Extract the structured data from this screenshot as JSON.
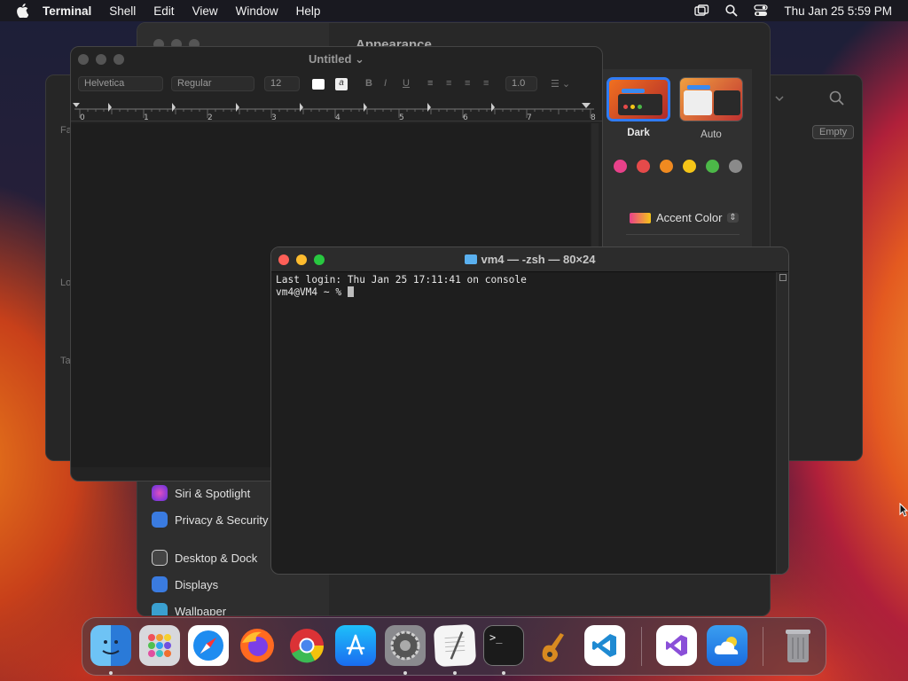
{
  "menubar": {
    "app": "Terminal",
    "items": [
      "Shell",
      "Edit",
      "View",
      "Window",
      "Help"
    ],
    "clock": "Thu Jan 25  5:59 PM"
  },
  "settings": {
    "header_partial": "Appearance",
    "sidebar": [
      {
        "label": "Siri & Spotlight",
        "color": "#b040c0"
      },
      {
        "label": "Privacy & Security",
        "color": "#3a7be0"
      },
      {
        "label": "Desktop & Dock",
        "color": "#555"
      },
      {
        "label": "Displays",
        "color": "#3a7be0"
      },
      {
        "label": "Wallpaper",
        "color": "#3aa0d0"
      }
    ],
    "appearance": {
      "options": [
        {
          "label": "Dark",
          "selected": true
        },
        {
          "label": "Auto",
          "selected": false
        }
      ],
      "accent_colors": [
        "#e8418a",
        "#e54a4a",
        "#f08a20",
        "#f5c518",
        "#4cb848",
        "#8a8a8a"
      ],
      "accent_label": "Accent Color"
    }
  },
  "back_window": {
    "empty_label": "Empty",
    "partial_labels": [
      "Fa",
      "Lo",
      "Ta"
    ]
  },
  "textedit": {
    "title": "Untitled",
    "font": "Helvetica",
    "style": "Regular",
    "size": "12",
    "spacing": "1.0",
    "ruler": [
      "0",
      "1",
      "2",
      "3",
      "4",
      "5",
      "6",
      "7",
      "8"
    ]
  },
  "terminal": {
    "title": "vm4 — -zsh — 80×24",
    "lines": [
      "Last login: Thu Jan 25 17:11:41 on console",
      "vm4@VM4 ~ % "
    ]
  },
  "dock": {
    "apps": [
      "finder",
      "launchpad",
      "safari",
      "firefox",
      "chrome",
      "app-store",
      "system-settings",
      "textedit",
      "terminal",
      "garageband",
      "vscode",
      "visual-studio",
      "weather",
      "trash"
    ]
  }
}
